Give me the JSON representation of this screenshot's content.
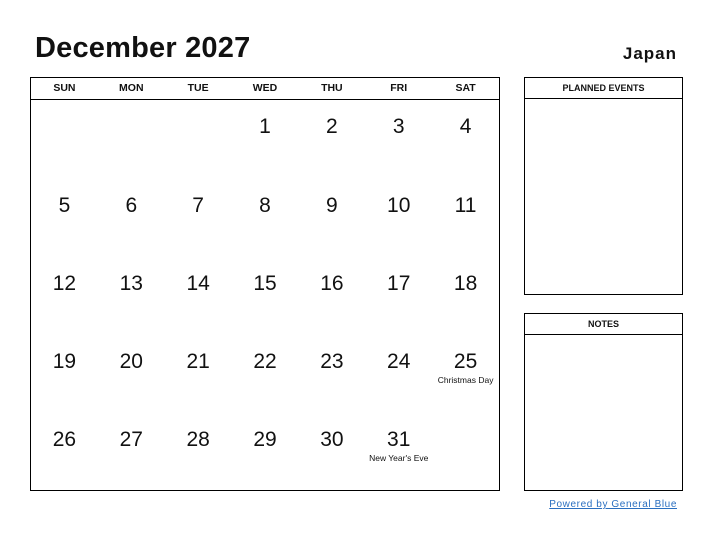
{
  "header": {
    "title": "December 2027",
    "country": "Japan"
  },
  "calendar": {
    "weekdays": [
      "SUN",
      "MON",
      "TUE",
      "WED",
      "THU",
      "FRI",
      "SAT"
    ],
    "weeks": [
      [
        {
          "d": ""
        },
        {
          "d": ""
        },
        {
          "d": ""
        },
        {
          "d": "1"
        },
        {
          "d": "2"
        },
        {
          "d": "3"
        },
        {
          "d": "4"
        }
      ],
      [
        {
          "d": "5"
        },
        {
          "d": "6"
        },
        {
          "d": "7"
        },
        {
          "d": "8"
        },
        {
          "d": "9"
        },
        {
          "d": "10"
        },
        {
          "d": "11"
        }
      ],
      [
        {
          "d": "12"
        },
        {
          "d": "13"
        },
        {
          "d": "14"
        },
        {
          "d": "15"
        },
        {
          "d": "16"
        },
        {
          "d": "17"
        },
        {
          "d": "18"
        }
      ],
      [
        {
          "d": "19"
        },
        {
          "d": "20"
        },
        {
          "d": "21"
        },
        {
          "d": "22"
        },
        {
          "d": "23"
        },
        {
          "d": "24"
        },
        {
          "d": "25",
          "h": "Christmas Day"
        }
      ],
      [
        {
          "d": "26"
        },
        {
          "d": "27"
        },
        {
          "d": "28"
        },
        {
          "d": "29"
        },
        {
          "d": "30"
        },
        {
          "d": "31",
          "h": "New Year's Eve"
        },
        {
          "d": ""
        }
      ]
    ]
  },
  "panels": {
    "planned_events": "PLANNED EVENTS",
    "notes": "NOTES"
  },
  "footer": {
    "credit": "Powered by General Blue",
    "link_color": "#2a6fc0"
  }
}
